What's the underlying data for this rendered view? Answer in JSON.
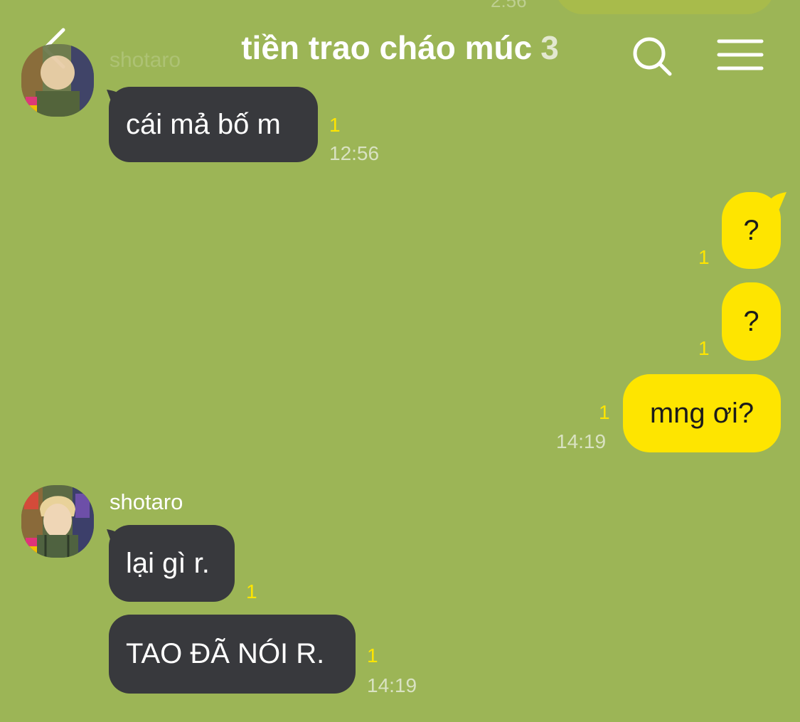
{
  "header": {
    "title": "tiền trao cháo múc",
    "member_count": "3",
    "back_icon": "chevron-left-icon",
    "search_icon": "search-icon",
    "menu_icon": "hamburger-menu-icon"
  },
  "top_ghost": {
    "time": "2:56",
    "sender": "shotaro"
  },
  "messages": [
    {
      "sender": "shotaro",
      "side": "left",
      "text": "cái mả bố m",
      "unread": "1",
      "time": "12:56"
    },
    {
      "side": "right",
      "text": "?",
      "unread": "1"
    },
    {
      "side": "right",
      "text": "?",
      "unread": "1"
    },
    {
      "side": "right",
      "text": "mng ơi?",
      "unread": "1",
      "time": "14:19"
    },
    {
      "sender": "shotaro",
      "side": "left",
      "text": "lại gì r.",
      "unread": "1"
    },
    {
      "side": "left",
      "text": "TAO ĐÃ NÓI R.",
      "unread": "1",
      "time": "14:19"
    }
  ],
  "colors": {
    "background": "#9cb556",
    "bubble_me": "#fee500",
    "bubble_other": "#38393d",
    "unread": "#fee500"
  }
}
